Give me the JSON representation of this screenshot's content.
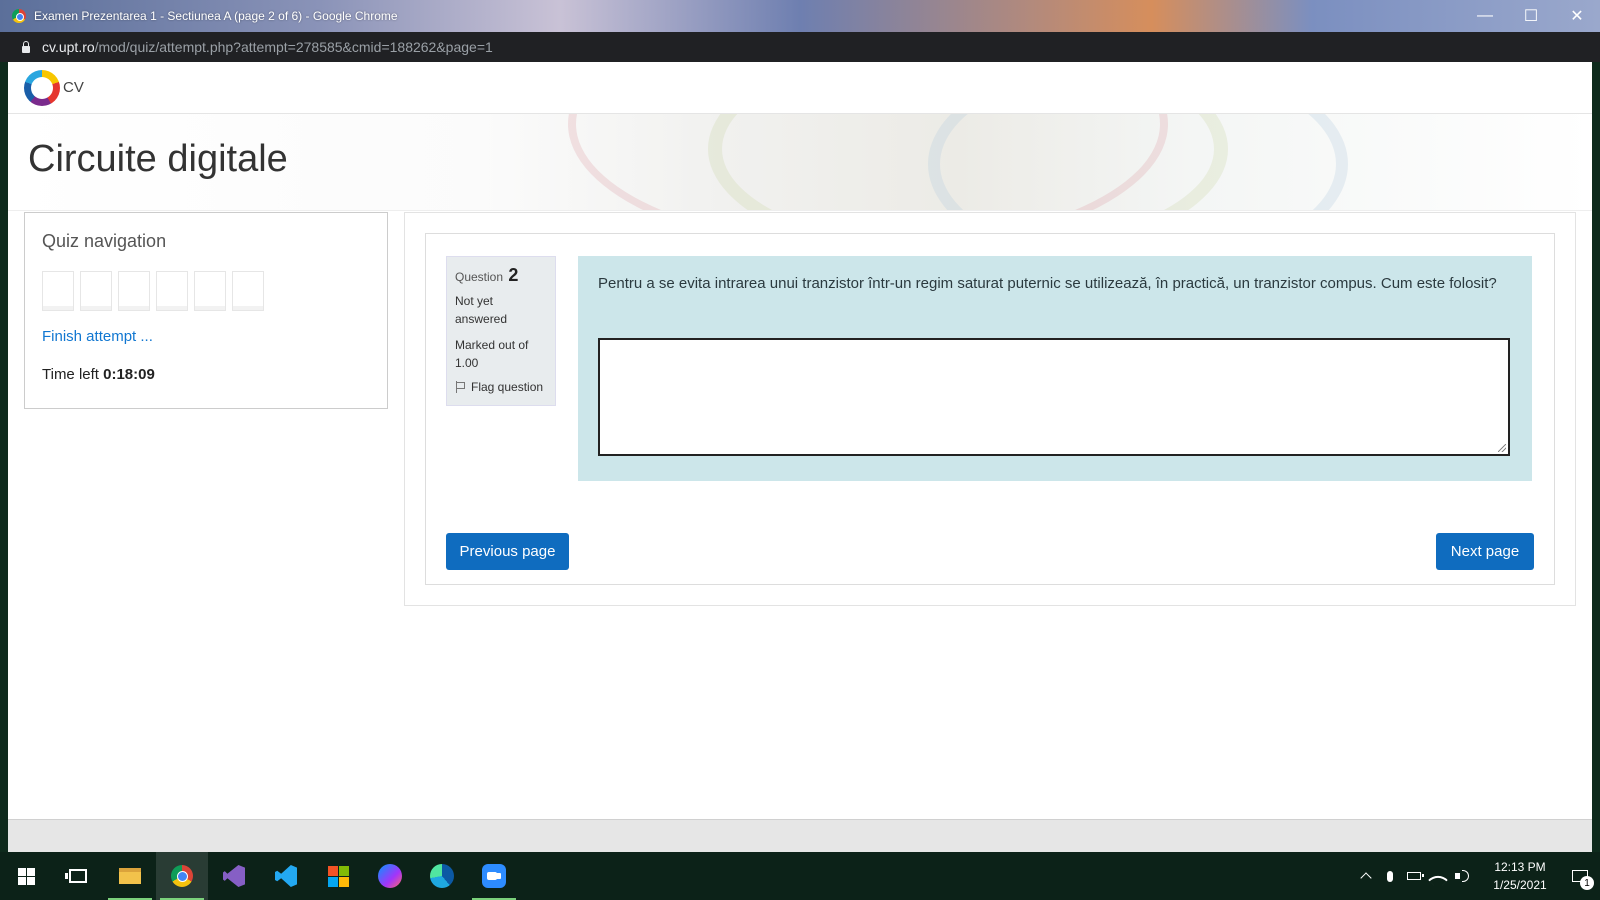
{
  "window": {
    "title": "Examen Prezentarea 1 - Sectiunea A (page 2 of 6) - Google Chrome",
    "minimize": "—",
    "maximize": "☐",
    "close": "✕"
  },
  "address": {
    "host": "cv.upt.ro",
    "path": "/mod/quiz/attempt.php?attempt=278585&cmid=188262&page=1"
  },
  "site": {
    "logo_text": "CV",
    "course_title": "Circuite digitale"
  },
  "quiz_nav": {
    "heading": "Quiz navigation",
    "finish_link": "Finish attempt ...",
    "time_label": "Time left",
    "time_value": "0:18:09",
    "question_buttons": [
      "",
      "",
      "",
      "",
      "",
      ""
    ]
  },
  "question": {
    "label": "Question",
    "number": "2",
    "state": "Not yet answered",
    "grade": "Marked out of 1.00",
    "flag": "Flag question",
    "text": "Pentru a se evita intrarea unui tranzistor într-un regim saturat puternic se utilizează, în practică, un tranzistor compus. Cum este folosit?",
    "answer": ""
  },
  "buttons": {
    "previous": "Previous page",
    "next": "Next page"
  },
  "taskbar": {
    "apps": [
      "start",
      "task-view",
      "file-explorer",
      "chrome",
      "visual-studio",
      "vscode",
      "microsoft-store",
      "messenger",
      "edge",
      "zoom"
    ],
    "time": "12:13 PM",
    "date": "1/25/2021",
    "notification_count": "1"
  },
  "colors": {
    "primary_button": "#0f6cbf",
    "link": "#1177d1",
    "question_bg": "#cce6ea",
    "info_bg": "#e8ecee"
  }
}
